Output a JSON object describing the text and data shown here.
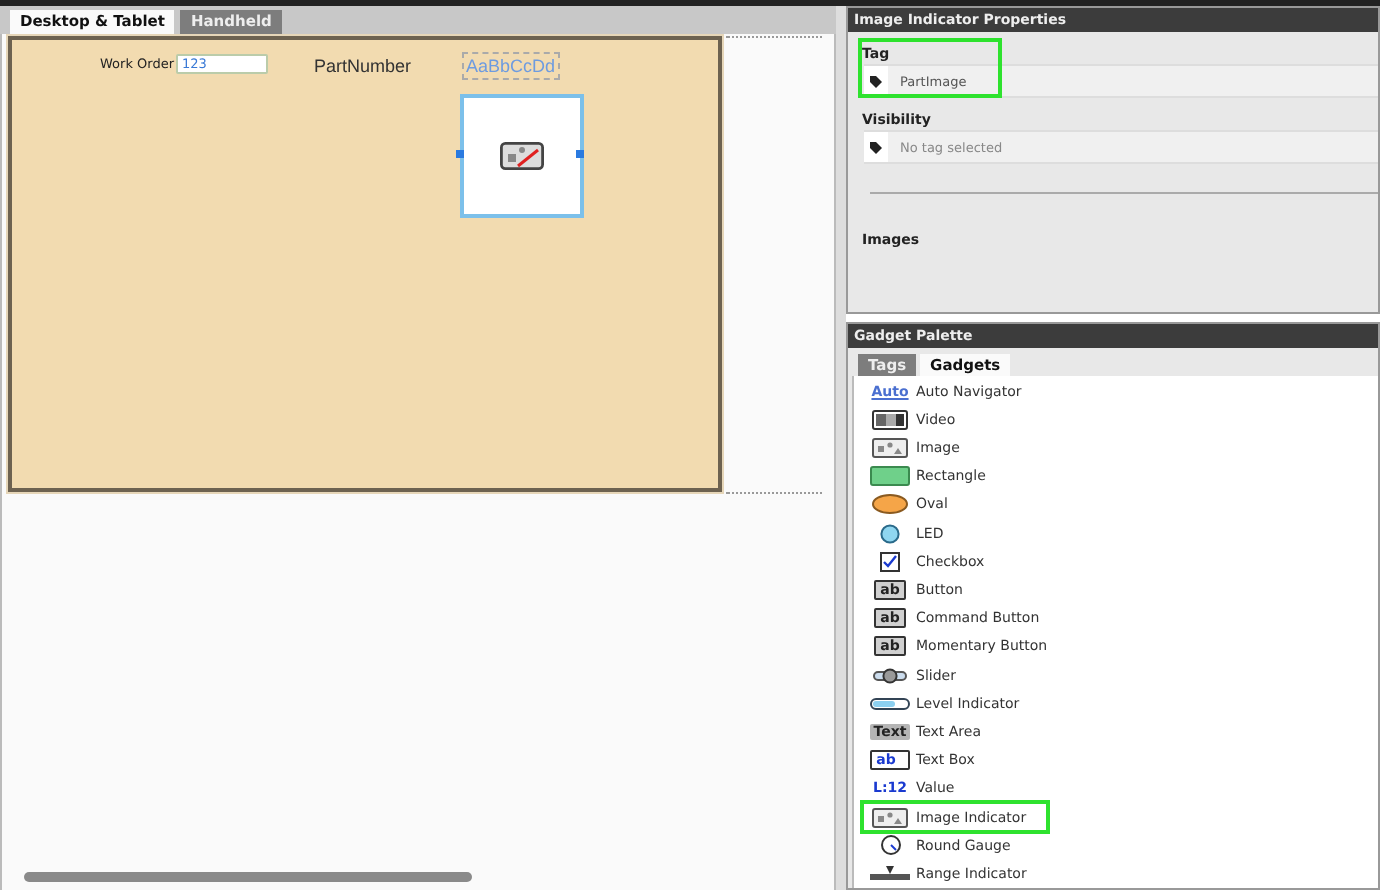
{
  "designer": {
    "tabs": [
      {
        "label": "Desktop & Tablet",
        "selected": true
      },
      {
        "label": "Handheld",
        "selected": false
      }
    ],
    "form": {
      "label": "Work Order",
      "input_value": "123",
      "part_label": "PartNumber",
      "text_sample": "AaBbCcDd",
      "image_indicator": {
        "selected": true
      }
    }
  },
  "properties": {
    "title": "Image Indicator Properties",
    "tag": {
      "label": "Tag",
      "value": "PartImage",
      "highlighted": true
    },
    "visibility": {
      "label": "Visibility",
      "placeholder": "No tag selected"
    },
    "images_label": "Images"
  },
  "palette": {
    "title": "Gadget Palette",
    "tabs": [
      {
        "label": "Tags",
        "selected": false
      },
      {
        "label": "Gadgets",
        "selected": true
      }
    ],
    "items": [
      {
        "kind": "auto",
        "icon_text": "Auto",
        "label": "Auto Navigator",
        "highlighted": false
      },
      {
        "kind": "video",
        "label": "Video",
        "highlighted": false
      },
      {
        "kind": "image",
        "label": "Image",
        "highlighted": false
      },
      {
        "kind": "rectangle",
        "label": "Rectangle",
        "highlighted": false
      },
      {
        "kind": "oval",
        "label": "Oval",
        "highlighted": false
      },
      {
        "kind": "led",
        "label": "LED",
        "highlighted": false
      },
      {
        "kind": "checkbox",
        "label": "Checkbox",
        "highlighted": false
      },
      {
        "kind": "button",
        "icon_text": "ab",
        "label": "Button",
        "highlighted": false
      },
      {
        "kind": "button",
        "icon_text": "ab",
        "label": "Command Button",
        "highlighted": false
      },
      {
        "kind": "button",
        "icon_text": "ab",
        "label": "Momentary Button",
        "highlighted": false
      },
      {
        "kind": "slider",
        "label": "Slider",
        "highlighted": false
      },
      {
        "kind": "level",
        "label": "Level Indicator",
        "highlighted": false
      },
      {
        "kind": "textarea",
        "icon_text": "Text",
        "label": "Text Area",
        "highlighted": false
      },
      {
        "kind": "textbox",
        "icon_text": "ab",
        "label": "Text Box",
        "highlighted": false
      },
      {
        "kind": "value",
        "icon_text": "L:12",
        "label": "Value",
        "highlighted": false
      },
      {
        "kind": "image",
        "label": "Image Indicator",
        "highlighted": true
      },
      {
        "kind": "gauge",
        "label": "Round Gauge",
        "highlighted": false
      },
      {
        "kind": "range",
        "label": "Range Indicator",
        "highlighted": false
      }
    ]
  }
}
